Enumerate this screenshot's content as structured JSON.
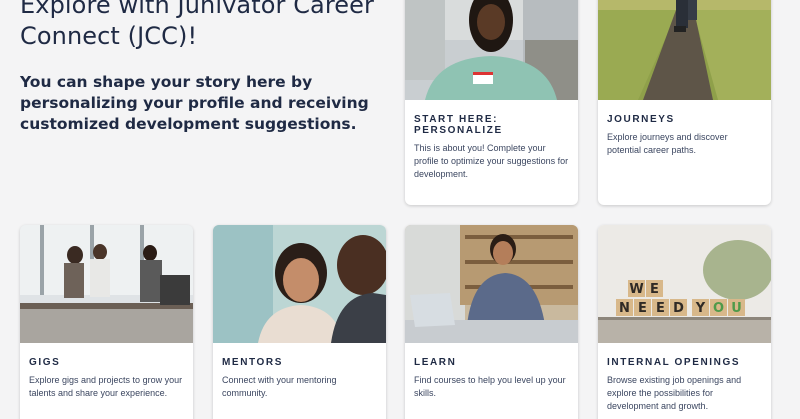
{
  "intro": {
    "heading": "Explore with Junivator Career Connect (JCC)!",
    "subheading": "You can shape your story here by personalizing your profile and receiving customized development suggestions."
  },
  "cards": {
    "start_here": {
      "title": "Start here: Personalize",
      "description": "This is about you! Complete your profile to optimize your suggestions for development."
    },
    "journeys": {
      "title": "Journeys",
      "description": "Explore journeys and discover potential career paths."
    },
    "gigs": {
      "title": "Gigs",
      "description": "Explore gigs and projects to grow your talents and share your experience."
    },
    "mentors": {
      "title": "Mentors",
      "description": "Connect with your mentoring community."
    },
    "learn": {
      "title": "Learn",
      "description": "Find courses to help you level up your skills."
    },
    "internal_openings": {
      "title": "Internal Openings",
      "description": "Browse existing job openings and explore the possibilities for development and growth.",
      "image_blocks_row1": [
        "W",
        "E"
      ],
      "image_blocks_row2": [
        "N",
        "E",
        "E",
        "D",
        "Y",
        "O",
        "U"
      ]
    }
  }
}
